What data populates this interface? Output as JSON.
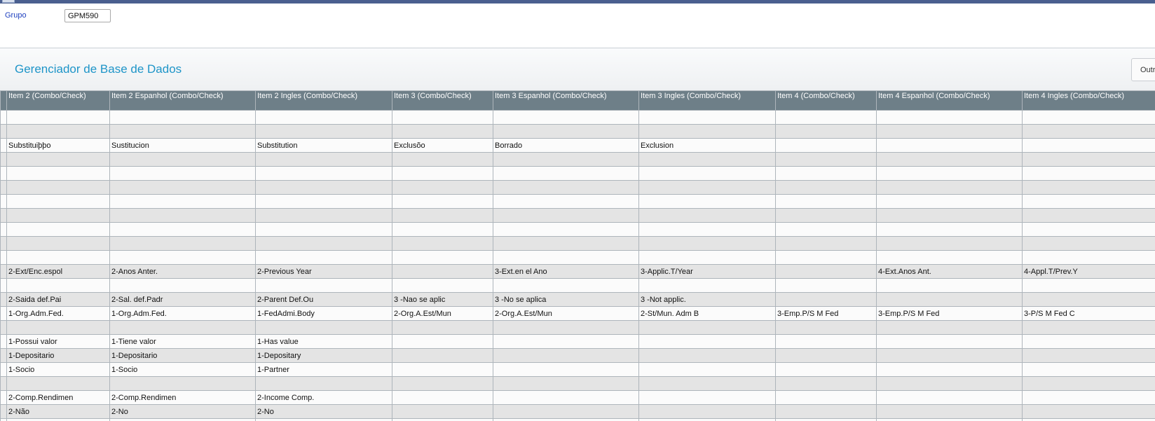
{
  "filter": {
    "label": "Grupo",
    "value": "GPM590"
  },
  "header": {
    "title": "Gerenciador de Base de Dados",
    "other_button": "Outr"
  },
  "grid": {
    "columns": [
      "Item 2 (Combo/Check)",
      "Item 2 Espanhol (Combo/Check)",
      "Item 2 Ingles (Combo/Check)",
      "Item 3 (Combo/Check)",
      "Item 3 Espanhol (Combo/Check)",
      "Item 3 Ingles (Combo/Check)",
      "Item 4 (Combo/Check)",
      "Item 4 Espanhol (Combo/Check)",
      "Item 4 Ingles (Combo/Check)"
    ],
    "rows": [
      [
        "",
        "",
        "",
        "",
        "",
        "",
        "",
        "",
        ""
      ],
      [
        "",
        "",
        "",
        "",
        "",
        "",
        "",
        "",
        ""
      ],
      [
        "Substituiþþo",
        "Sustitucion",
        "Substitution",
        "Exclusõo",
        "Borrado",
        "Exclusion",
        "",
        "",
        ""
      ],
      [
        "",
        "",
        "",
        "",
        "",
        "",
        "",
        "",
        ""
      ],
      [
        "",
        "",
        "",
        "",
        "",
        "",
        "",
        "",
        ""
      ],
      [
        "",
        "",
        "",
        "",
        "",
        "",
        "",
        "",
        ""
      ],
      [
        "",
        "",
        "",
        "",
        "",
        "",
        "",
        "",
        ""
      ],
      [
        "",
        "",
        "",
        "",
        "",
        "",
        "",
        "",
        ""
      ],
      [
        "",
        "",
        "",
        "",
        "",
        "",
        "",
        "",
        ""
      ],
      [
        "",
        "",
        "",
        "",
        "",
        "",
        "",
        "",
        ""
      ],
      [
        "",
        "",
        "",
        "",
        "",
        "",
        "",
        "",
        ""
      ],
      [
        "2-Ext/Enc.espol",
        "2-Anos Anter.",
        "2-Previous Year",
        "",
        "3-Ext.en el Ano",
        "3-Applic.T/Year",
        "",
        "4-Ext.Anos Ant.",
        "4-Appl.T/Prev.Y"
      ],
      [
        "",
        "",
        "",
        "",
        "",
        "",
        "",
        "",
        ""
      ],
      [
        "2-Saida def.Pai",
        "2-Sal. def.Padr",
        "2-Parent Def.Ou",
        "3 -Nao se aplic",
        "3 -No se aplica",
        "3 -Not applic.",
        "",
        "",
        ""
      ],
      [
        "1-Org.Adm.Fed.",
        "1-Org.Adm.Fed.",
        "1-FedAdmi.Body",
        "2-Org.A.Est/Mun",
        "2-Org.A.Est/Mun",
        "2-St/Mun. Adm B",
        "3-Emp.P/S M Fed",
        "3-Emp.P/S M Fed",
        "3-P/S M Fed C"
      ],
      [
        "",
        "",
        "",
        "",
        "",
        "",
        "",
        "",
        ""
      ],
      [
        "1-Possui valor",
        "1-Tiene valor",
        "1-Has value",
        "",
        "",
        "",
        "",
        "",
        ""
      ],
      [
        "1-Depositario",
        "1-Depositario",
        "1-Depositary",
        "",
        "",
        "",
        "",
        "",
        ""
      ],
      [
        "1-Socio",
        "1-Socio",
        "1-Partner",
        "",
        "",
        "",
        "",
        "",
        ""
      ],
      [
        "",
        "",
        "",
        "",
        "",
        "",
        "",
        "",
        ""
      ],
      [
        "2-Comp.Rendimen",
        "2-Comp.Rendimen",
        "2-Income Comp.",
        "",
        "",
        "",
        "",
        "",
        ""
      ],
      [
        "2-Não",
        "2-No",
        "2-No",
        "",
        "",
        "",
        "",
        "",
        ""
      ],
      [
        "",
        "",
        "",
        "",
        "",
        "",
        "",
        "",
        ""
      ]
    ]
  }
}
